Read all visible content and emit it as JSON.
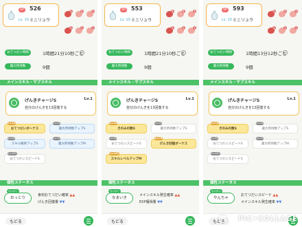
{
  "watermark": "PIC•COLLAGE",
  "colors": {
    "accent_green": "#37b85d",
    "skill_border": "#f3c45a",
    "gold_button": "#fbe79a",
    "nature_up": "#e05a3a",
    "nature_down": "#4a80e0"
  },
  "panels": [
    {
      "pokemon": {
        "sp_label": "SP",
        "sp_value": "526",
        "lv_label": "Lv. 10",
        "name": "ミニリュウ",
        "icon": "dratini-icon"
      },
      "ingredient_counts": [
        "5",
        "4",
        "3",
        "2",
        "1",
        "1"
      ],
      "stats": [
        {
          "label": "おてつだい時間",
          "value": "1時間21分10秒ごと"
        },
        {
          "label": "最大所持数",
          "value": "9個"
        }
      ],
      "section_skill": "メインスキル・サブスキル",
      "main_skill": {
        "name": "げんきチャージS",
        "lv": "Lv.1",
        "desc": "自分のげんきを13回復する"
      },
      "sub_skills": [
        {
          "label": "おてつだいボーナス",
          "lv": "Lv.10",
          "style": "gold"
        },
        {
          "label": "最大所持数アップS",
          "lv": "Lv.25",
          "style": "blue"
        },
        {
          "label": "スキル確率アップS",
          "lv": "Lv.50",
          "style": "blue"
        },
        {
          "label": "最大所持数アップM",
          "lv": "Lv.75",
          "style": "blue"
        },
        {
          "label": "おてつだいスピードS",
          "lv": "Lv.100",
          "style": "plain"
        }
      ],
      "section_nature": "個性ステータス",
      "nature": {
        "tag": "せいかく",
        "name": "おっとり",
        "line1": "食材おてつだい確率",
        "line1_sign": "▲▲",
        "line2": "げんき回復量",
        "line2_sign": "▼▼"
      },
      "back": "もどる"
    },
    {
      "pokemon": {
        "sp_label": "SP",
        "sp_value": "553",
        "lv_label": "Lv. 10",
        "name": "ミニリュウ",
        "icon": "dratini-icon"
      },
      "ingredient_counts": [
        "5",
        "4",
        "3",
        "2",
        "1",
        "1"
      ],
      "stats": [
        {
          "label": "おてつだい時間",
          "value": "1時間21分10秒ごと"
        },
        {
          "label": "最大所持数",
          "value": "9個"
        }
      ],
      "section_skill": "メインスキル・サブスキル",
      "main_skill": {
        "name": "げんきチャージS",
        "lv": "Lv.1",
        "desc": "自分のげんきを13回復する"
      },
      "sub_skills": [
        {
          "label": "きのみの数S",
          "lv": "Lv.10",
          "style": "gold"
        },
        {
          "label": "最大所持数アップS",
          "lv": "Lv.25",
          "style": "plain"
        },
        {
          "label": "おてつだいスピードS",
          "lv": "Lv.50",
          "style": "plain"
        },
        {
          "label": "げんき回復ボーナス",
          "lv": "Lv.75",
          "style": "gold"
        },
        {
          "label": "スキルレベルアップM",
          "lv": "Lv.100",
          "style": "gold"
        }
      ],
      "section_nature": "個性ステータス",
      "nature": {
        "tag": "せいかく",
        "name": "なまいき",
        "line1": "メインスキル発生確率",
        "line1_sign": "▲▲",
        "line2": "EXP獲得量",
        "line2_sign": "▼▼"
      },
      "back": "もどる"
    },
    {
      "pokemon": {
        "sp_label": "SP",
        "sp_value": "593",
        "lv_label": "Lv. 10",
        "name": "ミニリュウ",
        "icon": "dratini-icon"
      },
      "ingredient_counts": [
        "5",
        "4",
        "3",
        "2",
        "1",
        "1"
      ],
      "stats": [
        {
          "label": "おてつだい時間",
          "value": "1時間13分12秒ごと"
        },
        {
          "label": "最大所持数",
          "value": "9個"
        }
      ],
      "section_skill": "メインスキル・サブスキル",
      "main_skill": {
        "name": "げんきチャージS",
        "lv": "Lv.1",
        "desc": "自分のげんきを13回復する"
      },
      "sub_skills": [
        {
          "label": "きのみの数S",
          "lv": "Lv.10",
          "style": "gold"
        },
        {
          "label": "最大所持数アップS",
          "lv": "Lv.25",
          "style": "plain"
        },
        {
          "label": "おてつだいスピードS",
          "lv": "Lv.50",
          "style": "plain"
        },
        {
          "label": "最大所持数アップM",
          "lv": "Lv.75",
          "style": "plain"
        },
        {
          "label": "おてつだいスピードS",
          "lv": "Lv.100",
          "style": "plain"
        }
      ],
      "section_nature": "個性ステータス",
      "nature": {
        "tag": "せいかく",
        "name": "やんちゃ",
        "line1": "おてつだいスピード",
        "line1_sign": "▲▲",
        "line2": "メインスキル発生確率",
        "line2_sign": "▼▼"
      },
      "back": "もどる"
    }
  ]
}
